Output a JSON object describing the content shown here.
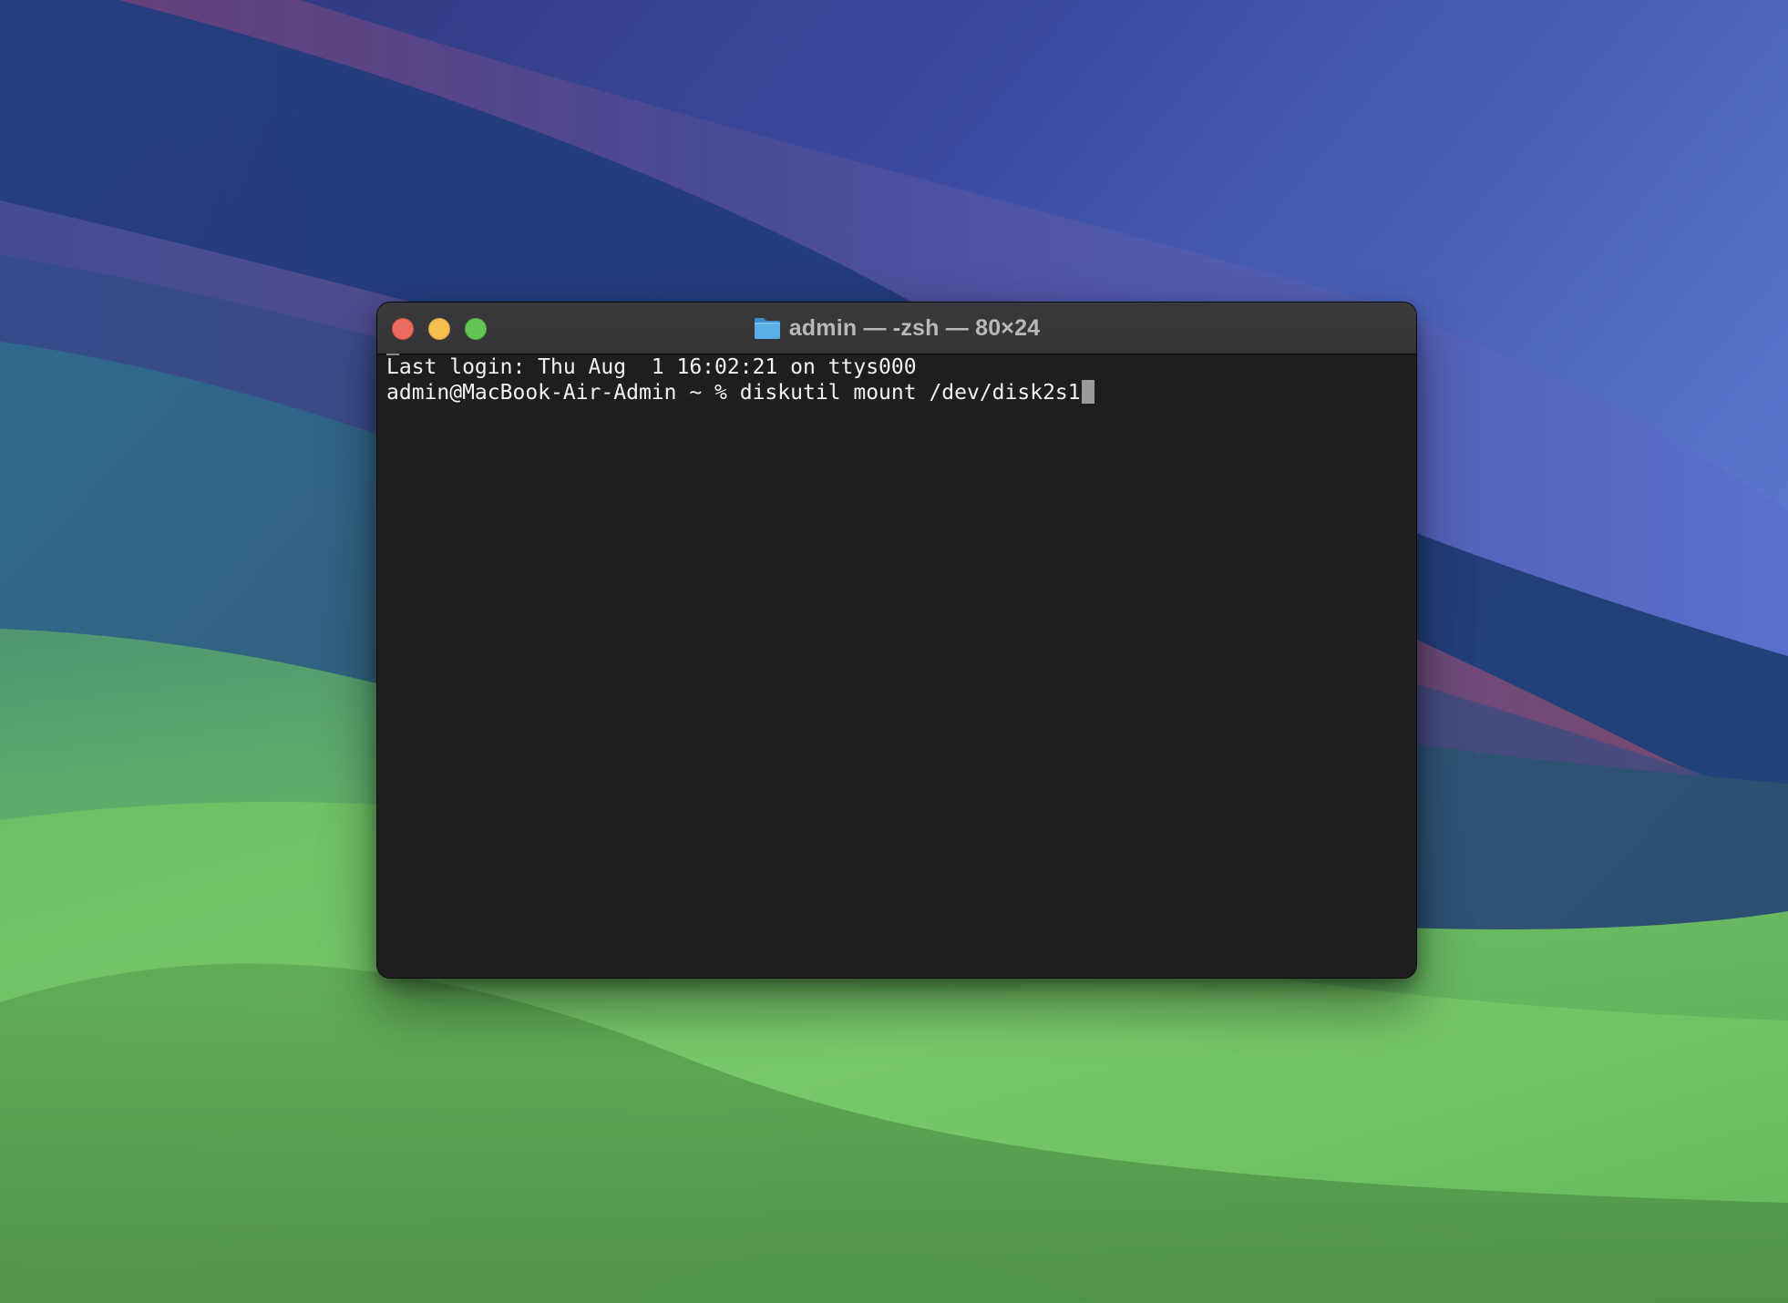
{
  "window": {
    "title": "admin — -zsh — 80×24",
    "title_icon": "folder-icon",
    "controls": [
      "close",
      "minimize",
      "zoom"
    ]
  },
  "terminal": {
    "line1": "Last login: Thu Aug  1 16:02:21 on ttys000",
    "prompt": "admin@MacBook-Air-Admin ~ % ",
    "command": "diskutil mount /dev/disk2s1"
  },
  "colors": {
    "close": "#ed6a5e",
    "minimize": "#f5bf4f",
    "zoom": "#61c554",
    "terminal_bg": "#1e1e1e",
    "folder": "#5aaee6"
  }
}
